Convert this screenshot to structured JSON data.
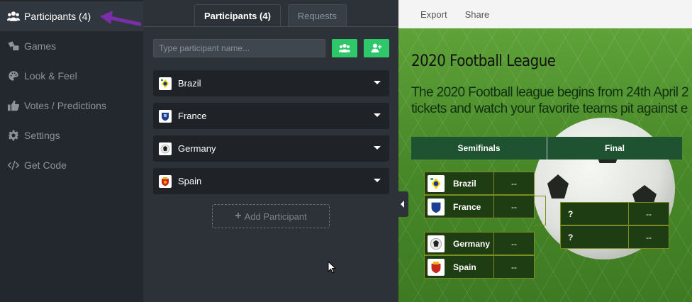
{
  "sidebar": {
    "items": [
      {
        "label": "Participants (4)",
        "icon": "users-icon",
        "active": true
      },
      {
        "label": "Games",
        "icon": "games-icon",
        "active": false
      },
      {
        "label": "Look & Feel",
        "icon": "palette-icon",
        "active": false
      },
      {
        "label": "Votes / Predictions",
        "icon": "thumbs-up-icon",
        "active": false
      },
      {
        "label": "Settings",
        "icon": "gear-icon",
        "active": false
      },
      {
        "label": "Get Code",
        "icon": "code-icon",
        "active": false
      }
    ]
  },
  "tabs": {
    "participants": "Participants (4)",
    "requests": "Requests"
  },
  "search": {
    "placeholder": "Type participant name...",
    "value": ""
  },
  "participants": [
    {
      "name": "Brazil"
    },
    {
      "name": "France"
    },
    {
      "name": "Germany"
    },
    {
      "name": "Spain"
    }
  ],
  "add_participant_label": "Add Participant",
  "toolbar": {
    "export": "Export",
    "share": "Share"
  },
  "tournament": {
    "title": "2020 Football League",
    "description_line1": "The 2020 Football league begins from 24th April 2",
    "description_line2": "tickets and watch your favorite teams pit against e",
    "rounds": [
      "Semifinals",
      "Final"
    ],
    "semifinals": [
      {
        "team": "Brazil",
        "score": "--"
      },
      {
        "team": "France",
        "score": "--"
      },
      {
        "team": "Germany",
        "score": "--"
      },
      {
        "team": "Spain",
        "score": "--"
      }
    ],
    "final": [
      {
        "team": "?",
        "score": "--"
      },
      {
        "team": "?",
        "score": "--"
      }
    ]
  },
  "colors": {
    "accent_green": "#2ec76a",
    "arrow_purple": "#7a2fa8",
    "round_header": "#1e5230"
  }
}
